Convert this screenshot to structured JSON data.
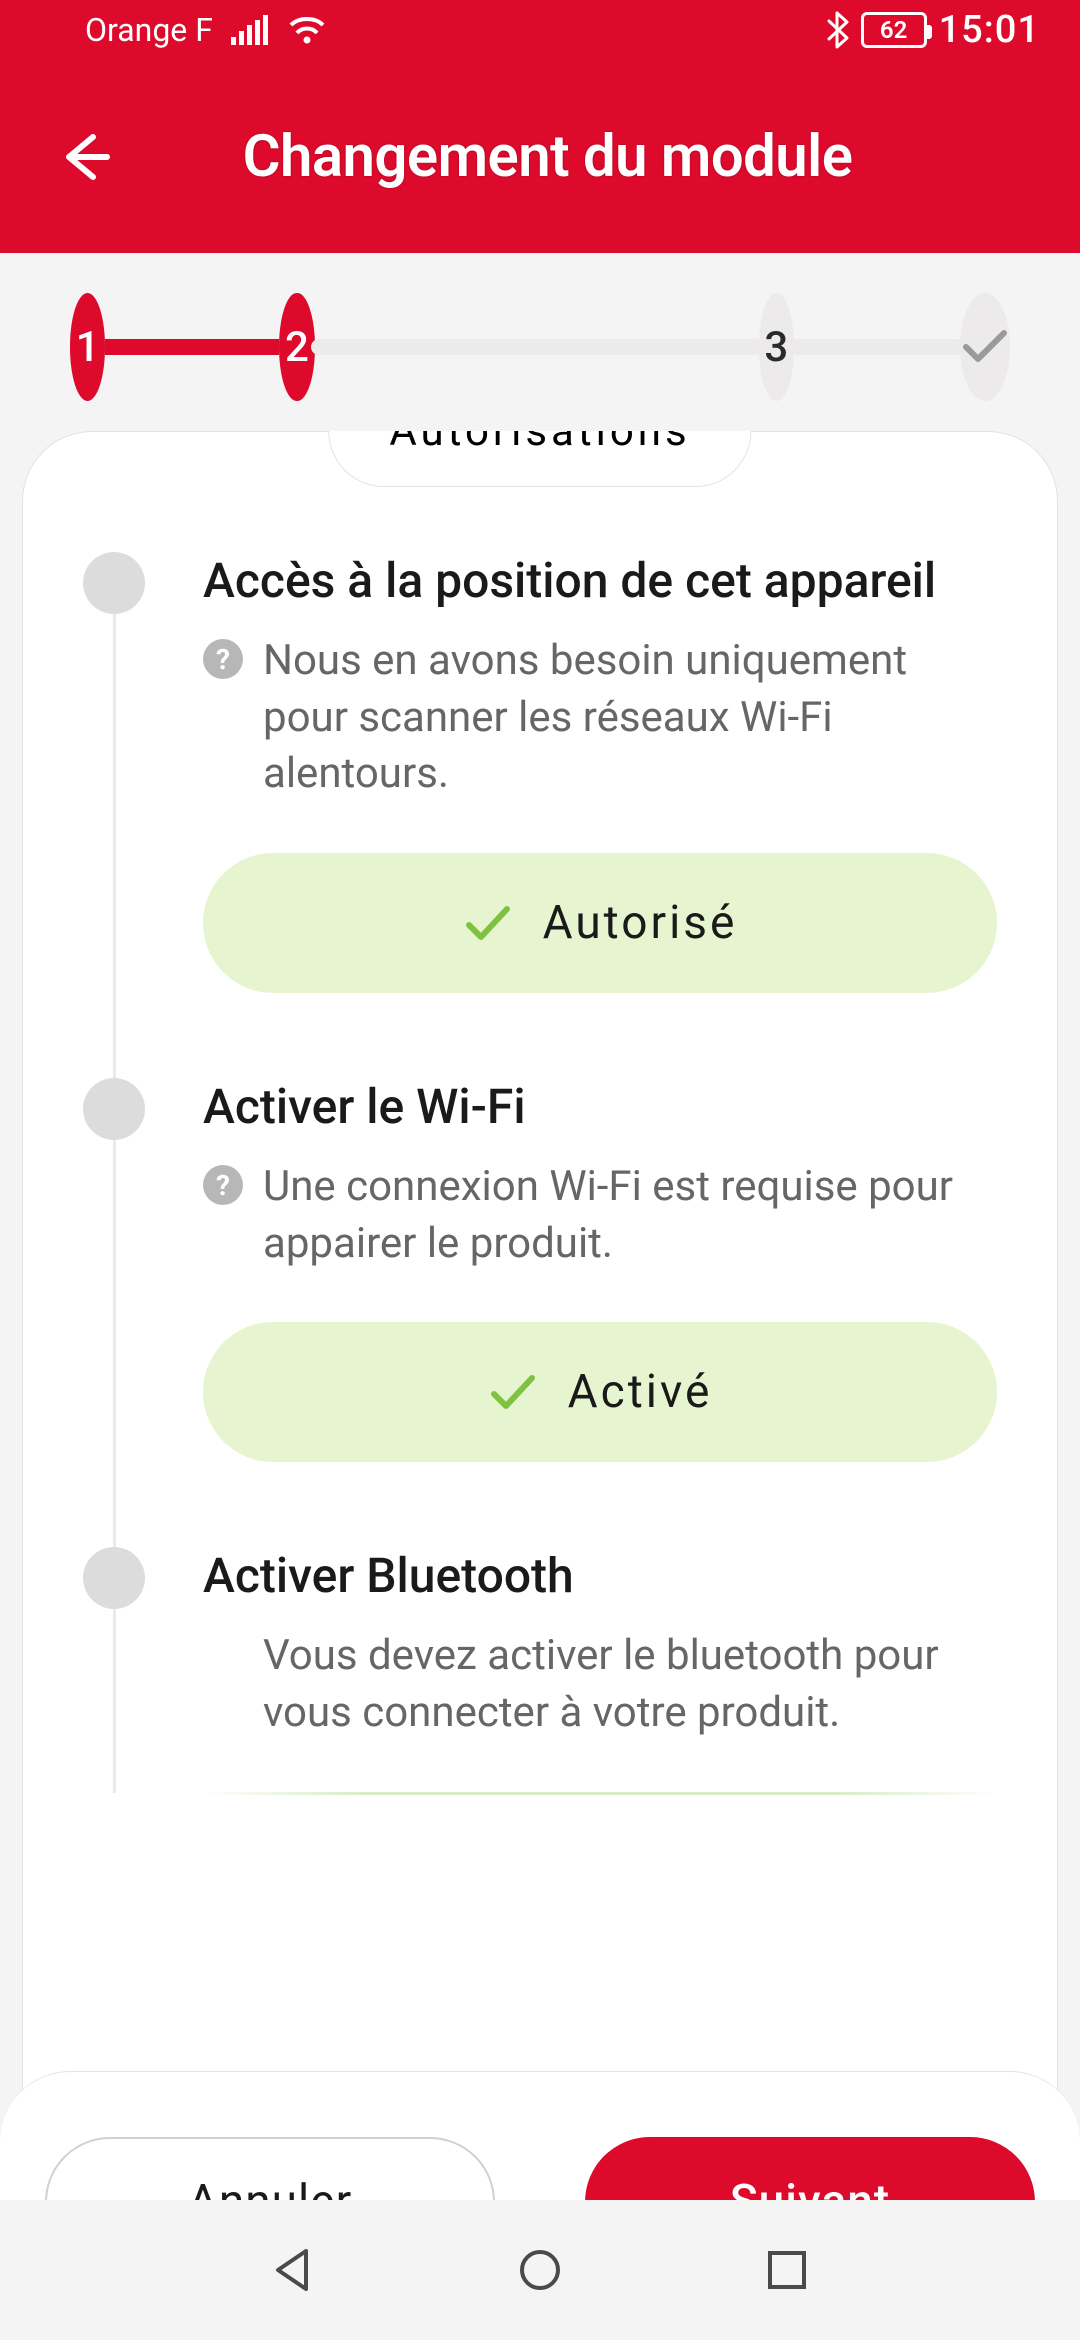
{
  "status_bar": {
    "carrier": "Orange F",
    "battery": "62",
    "time": "15:01"
  },
  "header": {
    "title": "Changement du module"
  },
  "stepper": {
    "step1": "1",
    "step2": "2",
    "step3": "3"
  },
  "card": {
    "badge": "Autorisations",
    "items": [
      {
        "title": "Accès à la position de cet appareil",
        "desc": "Nous en avons besoin uniquement pour scanner les réseaux Wi-Fi alentours.",
        "status": "Autorisé"
      },
      {
        "title": "Activer le Wi-Fi",
        "desc": "Une connexion Wi-Fi est requise pour appairer le produit.",
        "status": "Activé"
      },
      {
        "title": "Activer Bluetooth",
        "desc": "Vous devez activer le bluetooth pour vous connecter à votre produit."
      }
    ]
  },
  "buttons": {
    "cancel": "Annuler",
    "next": "Suivant"
  }
}
